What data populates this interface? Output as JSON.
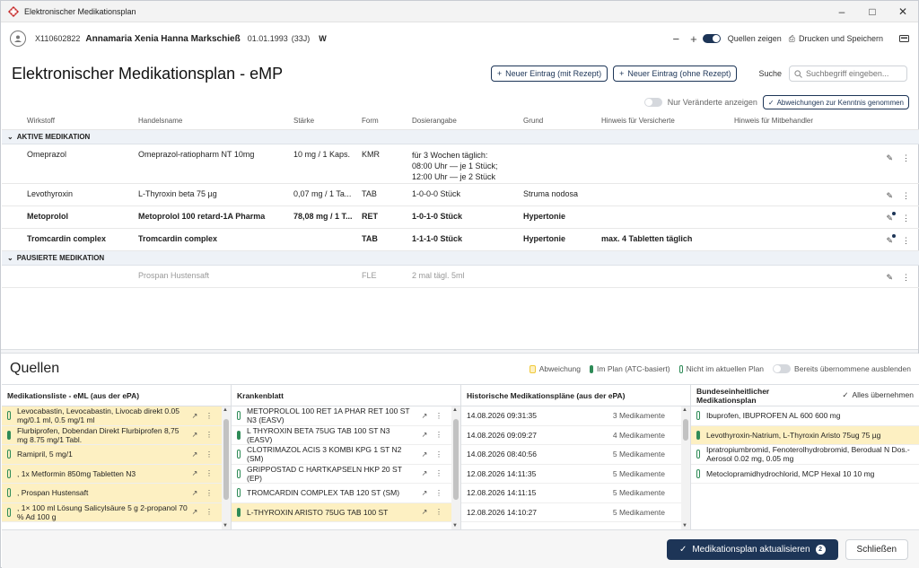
{
  "window": {
    "title": "Elektronischer Medikationsplan"
  },
  "patient": {
    "id": "X110602822",
    "name": "Annamaria Xenia Hanna Markschieß",
    "dob": "01.01.1993",
    "age": "(33J)",
    "gender": "W"
  },
  "header": {
    "zoom_out": "−",
    "zoom_in": "+",
    "sources_label": "Quellen zeigen",
    "print_label": "Drucken und Speichern"
  },
  "page": {
    "title": "Elektronischer Medikationsplan - eMP",
    "new_with_rx": "Neuer Eintrag (mit Rezept)",
    "new_without_rx": "Neuer Eintrag (ohne Rezept)",
    "search_label": "Suche",
    "search_placeholder": "Suchbegriff eingeben...",
    "only_changes": "Nur Veränderte anzeigen",
    "ack_button": "Abweichungen zur Kenntnis genommen"
  },
  "columns": [
    "Wirkstoff",
    "Handelsname",
    "Stärke",
    "Form",
    "Dosierangabe",
    "Grund",
    "Hinweis für Versicherte",
    "Hinweis für Mitbehandler"
  ],
  "sections": {
    "active": "AKTIVE MEDIKATION",
    "paused": "PAUSIERTE MEDIKATION"
  },
  "active_rows": [
    {
      "wirkstoff": "Omeprazol",
      "handelsname": "Omeprazol-ratiopharm NT 10mg",
      "staerke": "10 mg / 1 Kaps.",
      "form": "KMR",
      "dosis": [
        "für 3 Wochen täglich:",
        "08:00 Uhr — je 1 Stück;",
        "12:00 Uhr — je 2 Stück"
      ],
      "grund": "",
      "hinweis": "",
      "bold": false
    },
    {
      "wirkstoff": "Levothyroxin",
      "handelsname": "L-Thyroxin beta 75 µg",
      "staerke": "0,07 mg / 1 Ta...",
      "form": "TAB",
      "dosis": [
        "1-0-0-0 Stück"
      ],
      "grund": "Struma nodosa",
      "hinweis": "",
      "bold": false
    },
    {
      "wirkstoff": "Metoprolol",
      "handelsname": "Metoprolol 100 retard-1A Pharma",
      "staerke": "78,08 mg / 1 T...",
      "form": "RET",
      "dosis": [
        "1-0-1-0 Stück"
      ],
      "grund": "Hypertonie",
      "hinweis": "",
      "bold": true
    },
    {
      "wirkstoff": "Tromcardin complex",
      "handelsname": "Tromcardin complex",
      "staerke": "",
      "form": "TAB",
      "dosis": [
        "1-1-1-0 Stück"
      ],
      "grund": "Hypertonie",
      "hinweis": "max. 4 Tabletten täglich",
      "bold": true
    }
  ],
  "paused_rows": [
    {
      "wirkstoff": "",
      "handelsname": "Prospan Hustensaft",
      "staerke": "",
      "form": "FLE",
      "dosis": [
        "2 mal tägl. 5ml"
      ],
      "grund": "",
      "hinweis": ""
    }
  ],
  "sources": {
    "title": "Quellen",
    "legend": {
      "deviation": "Abweichung",
      "in_plan": "Im Plan (ATC-basiert)",
      "not_in_plan": "Nicht im aktuellen Plan",
      "hide_adopted": "Bereits übernommene ausblenden"
    },
    "colors": {
      "deviation": "#f7d54a",
      "in_plan": "#2e8b57",
      "primary": "#1d3557"
    },
    "eml": {
      "title": "Medikationsliste - eML (aus der ePA)",
      "items": [
        "Levocabastin, Levocabastin, Livocab direkt 0.05 mg/0.1 ml, 0.5 mg/1 ml",
        "Flurbiprofen, Dobendan Direkt Flurbiprofen 8,75 mg 8.75 mg/1 Tabl.",
        "Ramipril, 5 mg/1",
        ", 1x Metformin 850mg Tabletten N3",
        ", Prospan Hustensaft",
        ", 1× 100 ml Lösung Salicylsäure 5 g 2-propanol 70 % Ad 100 g"
      ]
    },
    "kb": {
      "title": "Krankenblatt",
      "items": [
        {
          "text": "METOPROLOL 100 RET 1A PHAR RET 100 ST N3 (EASV)",
          "fill": false,
          "yellow": false
        },
        {
          "text": "L THYROXIN BETA 75UG TAB 100 ST N3 (EASV)",
          "fill": true,
          "yellow": false
        },
        {
          "text": "CLOTRIMAZOL ACIS 3 KOMBI KPG 1 ST N2 (SM)",
          "fill": false,
          "yellow": false
        },
        {
          "text": "GRIPPOSTAD C HARTKAPSELN HKP 20 ST (EP)",
          "fill": false,
          "yellow": false
        },
        {
          "text": "TROMCARDIN COMPLEX TAB 120 ST (SM)",
          "fill": false,
          "yellow": false
        },
        {
          "text": "L-THYROXIN ARISTO 75UG TAB 100 ST",
          "fill": true,
          "yellow": true
        }
      ]
    },
    "hist": {
      "title": "Historische Medikationspläne (aus der ePA)",
      "items": [
        {
          "date": "14.08.2026 09:31:35",
          "count": "3 Medikamente"
        },
        {
          "date": "14.08.2026 09:09:27",
          "count": "4 Medikamente"
        },
        {
          "date": "14.08.2026 08:40:56",
          "count": "5 Medikamente"
        },
        {
          "date": "12.08.2026 14:11:35",
          "count": "5 Medikamente"
        },
        {
          "date": "12.08.2026 14:11:15",
          "count": "5 Medikamente"
        },
        {
          "date": "12.08.2026 14:10:27",
          "count": "5 Medikamente"
        }
      ]
    },
    "bmp": {
      "title": "Bundeseinheitlicher Medikationsplan",
      "adopt_all": "Alles übernehmen",
      "items": [
        {
          "text": "Ibuprofen, IBUPROFEN AL 600 600 mg",
          "fill": false,
          "yellow": false
        },
        {
          "text": "Levothyroxin-Natrium, L-Thyroxin Aristo 75ug 75 µg",
          "fill": true,
          "yellow": true
        },
        {
          "text": "Ipratropiumbromid, Fenoterolhydrobromid, Berodual N Dos.-Aerosol 0.02 mg, 0.05 mg",
          "fill": false,
          "yellow": false
        },
        {
          "text": "Metoclopramidhydrochlorid, MCP Hexal 10 10 mg",
          "fill": false,
          "yellow": false
        }
      ]
    }
  },
  "footer": {
    "update_label": "Medikationsplan aktualisieren",
    "update_count": "2",
    "close_label": "Schließen"
  }
}
